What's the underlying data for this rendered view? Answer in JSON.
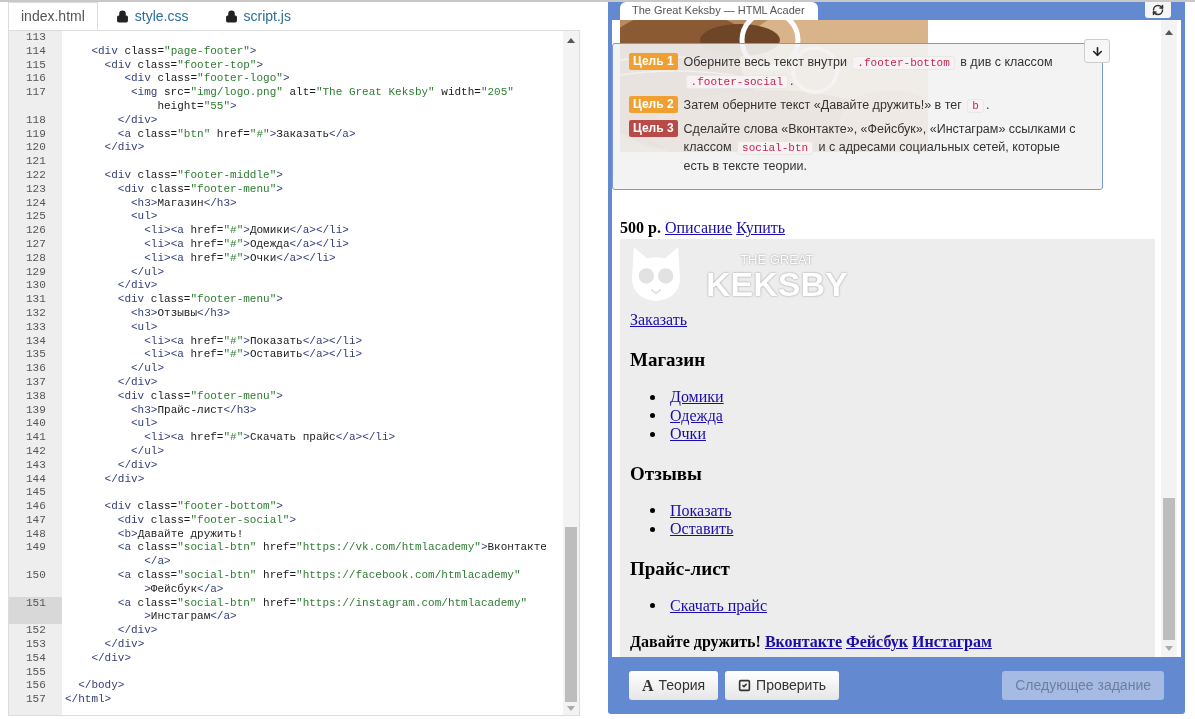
{
  "editor": {
    "tabs": [
      {
        "label": "index.html",
        "selected": true,
        "locked": false
      },
      {
        "label": "style.css",
        "selected": false,
        "locked": true
      },
      {
        "label": "script.js",
        "selected": false,
        "locked": true
      }
    ],
    "lines": [
      {
        "number": "113",
        "active": false
      },
      {
        "number": "114",
        "active": false,
        "parts": [
          "    <div class=\"page-footer\">"
        ]
      },
      {
        "number": "115",
        "active": false,
        "parts": [
          "      <div class=\"footer-top\">"
        ]
      },
      {
        "number": "116",
        "active": false,
        "parts": [
          "         <div class=\"footer-logo\">"
        ]
      },
      {
        "number": "117",
        "active": false,
        "parts": [
          "          <img src=\"img/logo.png\" alt=\"The Great Keksby\" width=\"205\"",
          "              height=\"55\">"
        ]
      },
      {
        "number": "118",
        "active": false,
        "parts": [
          "        </div>"
        ]
      },
      {
        "number": "119",
        "active": false,
        "parts": [
          "        <a class=\"btn\" href=\"#\">Заказать</a>"
        ]
      },
      {
        "number": "120",
        "active": false,
        "parts": [
          "      </div>"
        ]
      },
      {
        "number": "121",
        "active": false
      },
      {
        "number": "122",
        "active": false,
        "parts": [
          "      <div class=\"footer-middle\">"
        ]
      },
      {
        "number": "123",
        "active": false,
        "parts": [
          "        <div class=\"footer-menu\">"
        ]
      },
      {
        "number": "124",
        "active": false,
        "parts": [
          "          <h3>Магазин</h3>"
        ]
      },
      {
        "number": "125",
        "active": false,
        "parts": [
          "          <ul>"
        ]
      },
      {
        "number": "126",
        "active": false,
        "parts": [
          "            <li><a href=\"#\">Домики</a></li>"
        ]
      },
      {
        "number": "127",
        "active": false,
        "parts": [
          "            <li><a href=\"#\">Одежда</a></li>"
        ]
      },
      {
        "number": "128",
        "active": false,
        "parts": [
          "            <li><a href=\"#\">Очки</a></li>"
        ]
      },
      {
        "number": "129",
        "active": false,
        "parts": [
          "          </ul>"
        ]
      },
      {
        "number": "130",
        "active": false,
        "parts": [
          "        </div>"
        ]
      },
      {
        "number": "131",
        "active": false,
        "parts": [
          "        <div class=\"footer-menu\">"
        ]
      },
      {
        "number": "132",
        "active": false,
        "parts": [
          "          <h3>Отзывы</h3>"
        ]
      },
      {
        "number": "133",
        "active": false,
        "parts": [
          "          <ul>"
        ]
      },
      {
        "number": "134",
        "active": false,
        "parts": [
          "            <li><a href=\"#\">Показать</a></li>"
        ]
      },
      {
        "number": "135",
        "active": false,
        "parts": [
          "            <li><a href=\"#\">Оставить</a></li>"
        ]
      },
      {
        "number": "136",
        "active": false,
        "parts": [
          "          </ul>"
        ]
      },
      {
        "number": "137",
        "active": false,
        "parts": [
          "        </div>"
        ]
      },
      {
        "number": "138",
        "active": false,
        "parts": [
          "        <div class=\"footer-menu\">"
        ]
      },
      {
        "number": "139",
        "active": false,
        "parts": [
          "          <h3>Прайс-лист</h3>"
        ]
      },
      {
        "number": "140",
        "active": false,
        "parts": [
          "          <ul>"
        ]
      },
      {
        "number": "141",
        "active": false,
        "parts": [
          "            <li><a href=\"#\">Скачать прайс</a></li>"
        ]
      },
      {
        "number": "142",
        "active": false,
        "parts": [
          "          </ul>"
        ]
      },
      {
        "number": "143",
        "active": false,
        "parts": [
          "        </div>"
        ]
      },
      {
        "number": "144",
        "active": false,
        "parts": [
          "      </div>"
        ]
      },
      {
        "number": "145",
        "active": false
      },
      {
        "number": "146",
        "active": false,
        "parts": [
          "      <div class=\"footer-bottom\">"
        ]
      },
      {
        "number": "147",
        "active": false,
        "parts": [
          "        <div class=\"footer-social\">"
        ]
      },
      {
        "number": "148",
        "active": false,
        "parts": [
          "        <b>Давайте дружить!"
        ]
      },
      {
        "number": "149",
        "active": false,
        "parts": [
          "        <a class=\"social-btn\" href=\"https://vk.com/htmlacademy\">Вконтакте",
          "            </a>"
        ]
      },
      {
        "number": "150",
        "active": false,
        "parts": [
          "        <a class=\"social-btn\" href=\"https://facebook.com/htmlacademy\"",
          "            >Фейсбук</a>"
        ]
      },
      {
        "number": "151",
        "active": true,
        "parts": [
          "        <a class=\"social-btn\" href=\"https://instagram.com/htmlacademy\"",
          "            >Инстаграм</a>"
        ]
      },
      {
        "number": "152",
        "active": false,
        "parts": [
          "        </div>"
        ]
      },
      {
        "number": "153",
        "active": false,
        "parts": [
          "      </div>"
        ]
      },
      {
        "number": "154",
        "active": false,
        "parts": [
          "    </div>"
        ]
      },
      {
        "number": "155",
        "active": false
      },
      {
        "number": "156",
        "active": false,
        "parts": [
          "  </body>"
        ]
      },
      {
        "number": "157",
        "active": false,
        "parts": [
          "</html>"
        ]
      }
    ]
  },
  "preview": {
    "tab_title": "The Great Keksby — HTML Acader",
    "price": "500 р.",
    "links": [
      "Описание",
      "Купить"
    ],
    "footer": {
      "logo_small": "THE GREAT",
      "logo_big": "KEKSBY",
      "order_link": "Заказать",
      "menus": [
        {
          "heading": "Магазин",
          "items": [
            "Домики",
            "Одежда",
            "Очки"
          ]
        },
        {
          "heading": "Отзывы",
          "items": [
            "Показать",
            "Оставить"
          ]
        },
        {
          "heading": "Прайс-лист",
          "items": [
            "Скачать прайс"
          ]
        }
      ],
      "social_lead": "Давайте дружить!",
      "social_links": [
        "Вконтакте",
        "Фейсбук",
        "Инстаграм"
      ]
    }
  },
  "goals": [
    {
      "label": "Цель 1",
      "color": "#f0a030",
      "parts": [
        {
          "kind": "text",
          "text": "Оберните весь текст внутри "
        },
        {
          "kind": "code",
          "text": ".footer-bottom"
        },
        {
          "kind": "text",
          "text": " в див с классом "
        },
        {
          "kind": "code",
          "text": ".footer-social"
        },
        {
          "kind": "text",
          "text": "."
        }
      ]
    },
    {
      "label": "Цель 2",
      "color": "#f0a030",
      "parts": [
        {
          "kind": "text",
          "text": "Затем оберните текст «Давайте дружить!» в тег "
        },
        {
          "kind": "code",
          "text": "b"
        },
        {
          "kind": "text",
          "text": "."
        }
      ]
    },
    {
      "label": "Цель 3",
      "color": "#b94a48",
      "parts": [
        {
          "kind": "text",
          "text": "Сделайте слова «Вконтакте», «Фейсбук», «Инстаграм» ссылками с классом "
        },
        {
          "kind": "code",
          "text": "social-btn"
        },
        {
          "kind": "text",
          "text": " и с адресами социальных сетей, которые есть в тексте теории."
        }
      ]
    }
  ],
  "buttons": [
    {
      "label": "Теория",
      "glyph": "A",
      "kind": "theory",
      "disabled": false
    },
    {
      "label": "Проверить",
      "kind": "check",
      "disabled": false
    },
    {
      "label": "Следующее задание",
      "kind": "next",
      "disabled": true
    }
  ]
}
